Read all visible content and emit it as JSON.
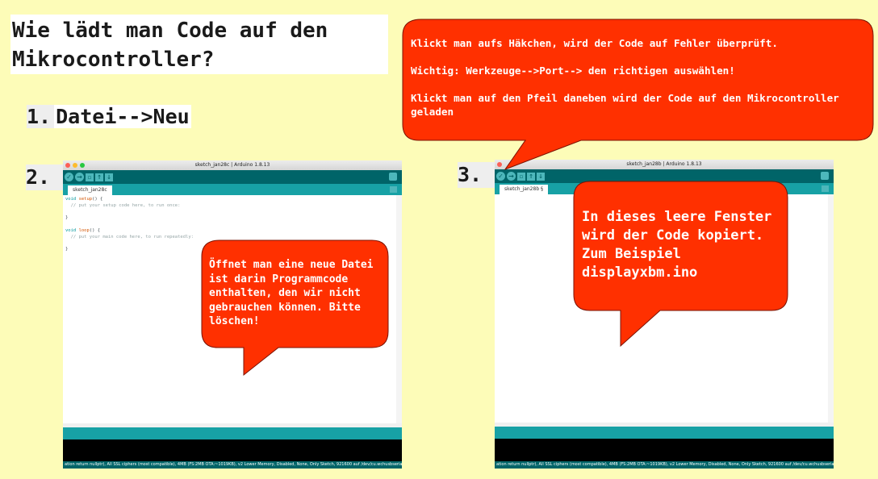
{
  "title": "Wie lädt man Code auf den\nMikrocontroller?",
  "steps": {
    "step1_num": "1.",
    "step1_text": "Datei-->Neu",
    "step2_num": "2.",
    "step3_num": "3."
  },
  "ide_left": {
    "window_title": "sketch_jan28c | Arduino 1.8.13",
    "tab_label": "sketch_jan28c",
    "code": {
      "l1_kw": "void",
      "l1_fn": "setup",
      "l1_rest": "() {",
      "l2": "  // put your setup code here, to run once:",
      "l3": "}",
      "l4_kw": "void",
      "l4_fn": "loop",
      "l4_rest": "() {",
      "l5": "  // put your main code here, to run repeatedly:",
      "l6": "}"
    },
    "footer": "ation return nullptr), All SSL ciphers (most compatible), 4MB (FS:2MB OTA:~1019KB), v2 Lower Memory, Disabled, None, Only Sketch, 921600 auf /dev/cu.wchusbserial1410"
  },
  "ide_right": {
    "window_title": "sketch_jan28b | Arduino 1.8.13",
    "tab_label": "sketch_jan28b §",
    "footer": "ation return nullptr), All SSL ciphers (most compatible), 4MB (FS:2MB OTA:~1019KB), v2 Lower Memory, Disabled, None, Only Sketch, 921600 auf /dev/cu.wchusbserial1410"
  },
  "bubbles": {
    "top_p1": "Klickt man aufs Häkchen, wird der Code auf Fehler überprüft.",
    "top_p2": "Wichtig: Werkzeuge-->Port--> den richtigen auswählen!",
    "top_p3": "Klickt man auf den Pfeil daneben wird der Code auf den Mikrocontroller geladen",
    "left": "Öffnet man eine neue Datei ist darin Programmcode enthalten, den wir nicht gebrauchen können. Bitte löschen!",
    "right": "In dieses leere Fenster wird der Code kopiert. Zum Beispiel displayxbm.ino"
  },
  "colors": {
    "background": "#fdfcb8",
    "bubble_fill": "#ff3000",
    "bubble_stroke": "#7a1200",
    "ide_teal_dark": "#006468",
    "ide_teal": "#17a1a5"
  }
}
